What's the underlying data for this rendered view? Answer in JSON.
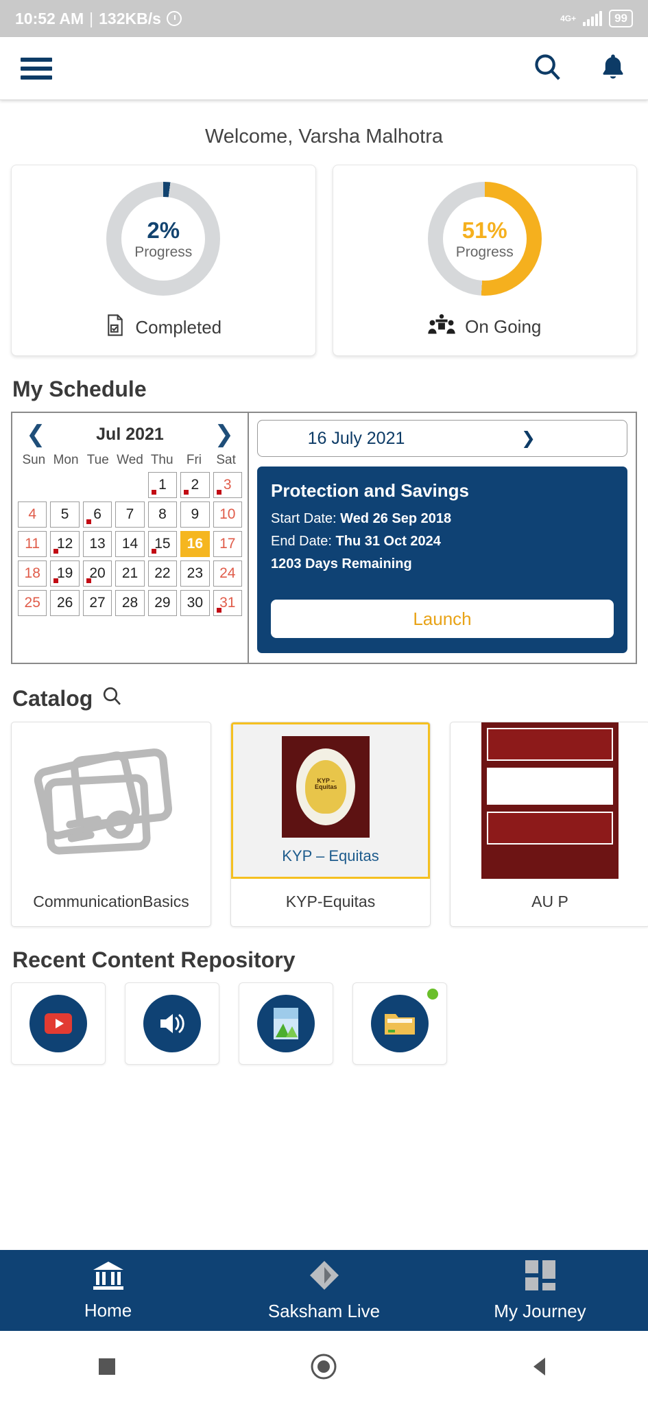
{
  "status_bar": {
    "time": "10:52 AM",
    "separator": "|",
    "network_speed": "132KB/s",
    "alarm_icon": "alarm-icon",
    "network_type": "4G+",
    "battery": "99"
  },
  "app_bar": {
    "menu_icon": "hamburger-menu-icon",
    "search_icon": "search-icon",
    "notification_icon": "bell-icon"
  },
  "welcome": {
    "text": "Welcome, Varsha Malhotra"
  },
  "progress_cards": [
    {
      "percent": "2%",
      "label": "Progress",
      "footer": "Completed",
      "icon": "document-check-icon",
      "color": "#12436f",
      "value": 2
    },
    {
      "percent": "51%",
      "label": "Progress",
      "footer": "On Going",
      "icon": "training-people-icon",
      "color": "#f5b01e",
      "value": 51
    }
  ],
  "schedule": {
    "title": "My Schedule",
    "calendar": {
      "month_label": "Jul 2021",
      "prev_icon": "chevron-left-icon",
      "next_icon": "chevron-right-icon",
      "weekdays": [
        "Sun",
        "Mon",
        "Tue",
        "Wed",
        "Thu",
        "Fri",
        "Sat"
      ],
      "selected_day": 16,
      "days_with_events": [
        1,
        2,
        3,
        6,
        12,
        15,
        19,
        20,
        31
      ],
      "weeks": [
        [
          null,
          null,
          null,
          null,
          1,
          2,
          3
        ],
        [
          4,
          5,
          6,
          7,
          8,
          9,
          10
        ],
        [
          11,
          12,
          13,
          14,
          15,
          16,
          17
        ],
        [
          18,
          19,
          20,
          21,
          22,
          23,
          24
        ],
        [
          25,
          26,
          27,
          28,
          29,
          30,
          31
        ]
      ]
    },
    "event": {
      "date_label": "16 July 2021",
      "date_next_icon": "chevron-right-icon",
      "title": "Protection and Savings",
      "start_label": "Start Date:",
      "start_value": "Wed 26 Sep 2018",
      "end_label": "End Date:",
      "end_value": "Thu 31 Oct 2024",
      "days_remaining": "1203  Days Remaining",
      "launch_label": "Launch"
    }
  },
  "catalog": {
    "title": "Catalog",
    "search_icon": "search-icon",
    "items": [
      {
        "name": "CommunicationBasics",
        "thumb": "cards-placeholder-icon",
        "active": false
      },
      {
        "name": "KYP-Equitas",
        "thumb": "kyp-poster-image",
        "thumb_caption": "KYP – Equitas",
        "active": true
      },
      {
        "name": "AU P",
        "thumb": "au-poster-image",
        "active": false
      }
    ]
  },
  "repository": {
    "title": "Recent Content Repository",
    "items": [
      {
        "icon": "video-play-icon",
        "badge": false
      },
      {
        "icon": "audio-speaker-icon",
        "badge": false
      },
      {
        "icon": "image-picture-icon",
        "badge": false
      },
      {
        "icon": "folder-icon",
        "badge": true
      }
    ]
  },
  "bottom_nav": [
    {
      "label": "Home",
      "icon": "bank-home-icon"
    },
    {
      "label": "Saksham Live",
      "icon": "diamond-live-icon"
    },
    {
      "label": "My Journey",
      "icon": "grid-journey-icon"
    }
  ],
  "system_nav": [
    {
      "icon": "recents-square-icon"
    },
    {
      "icon": "home-circle-icon"
    },
    {
      "icon": "back-triangle-icon"
    }
  ]
}
